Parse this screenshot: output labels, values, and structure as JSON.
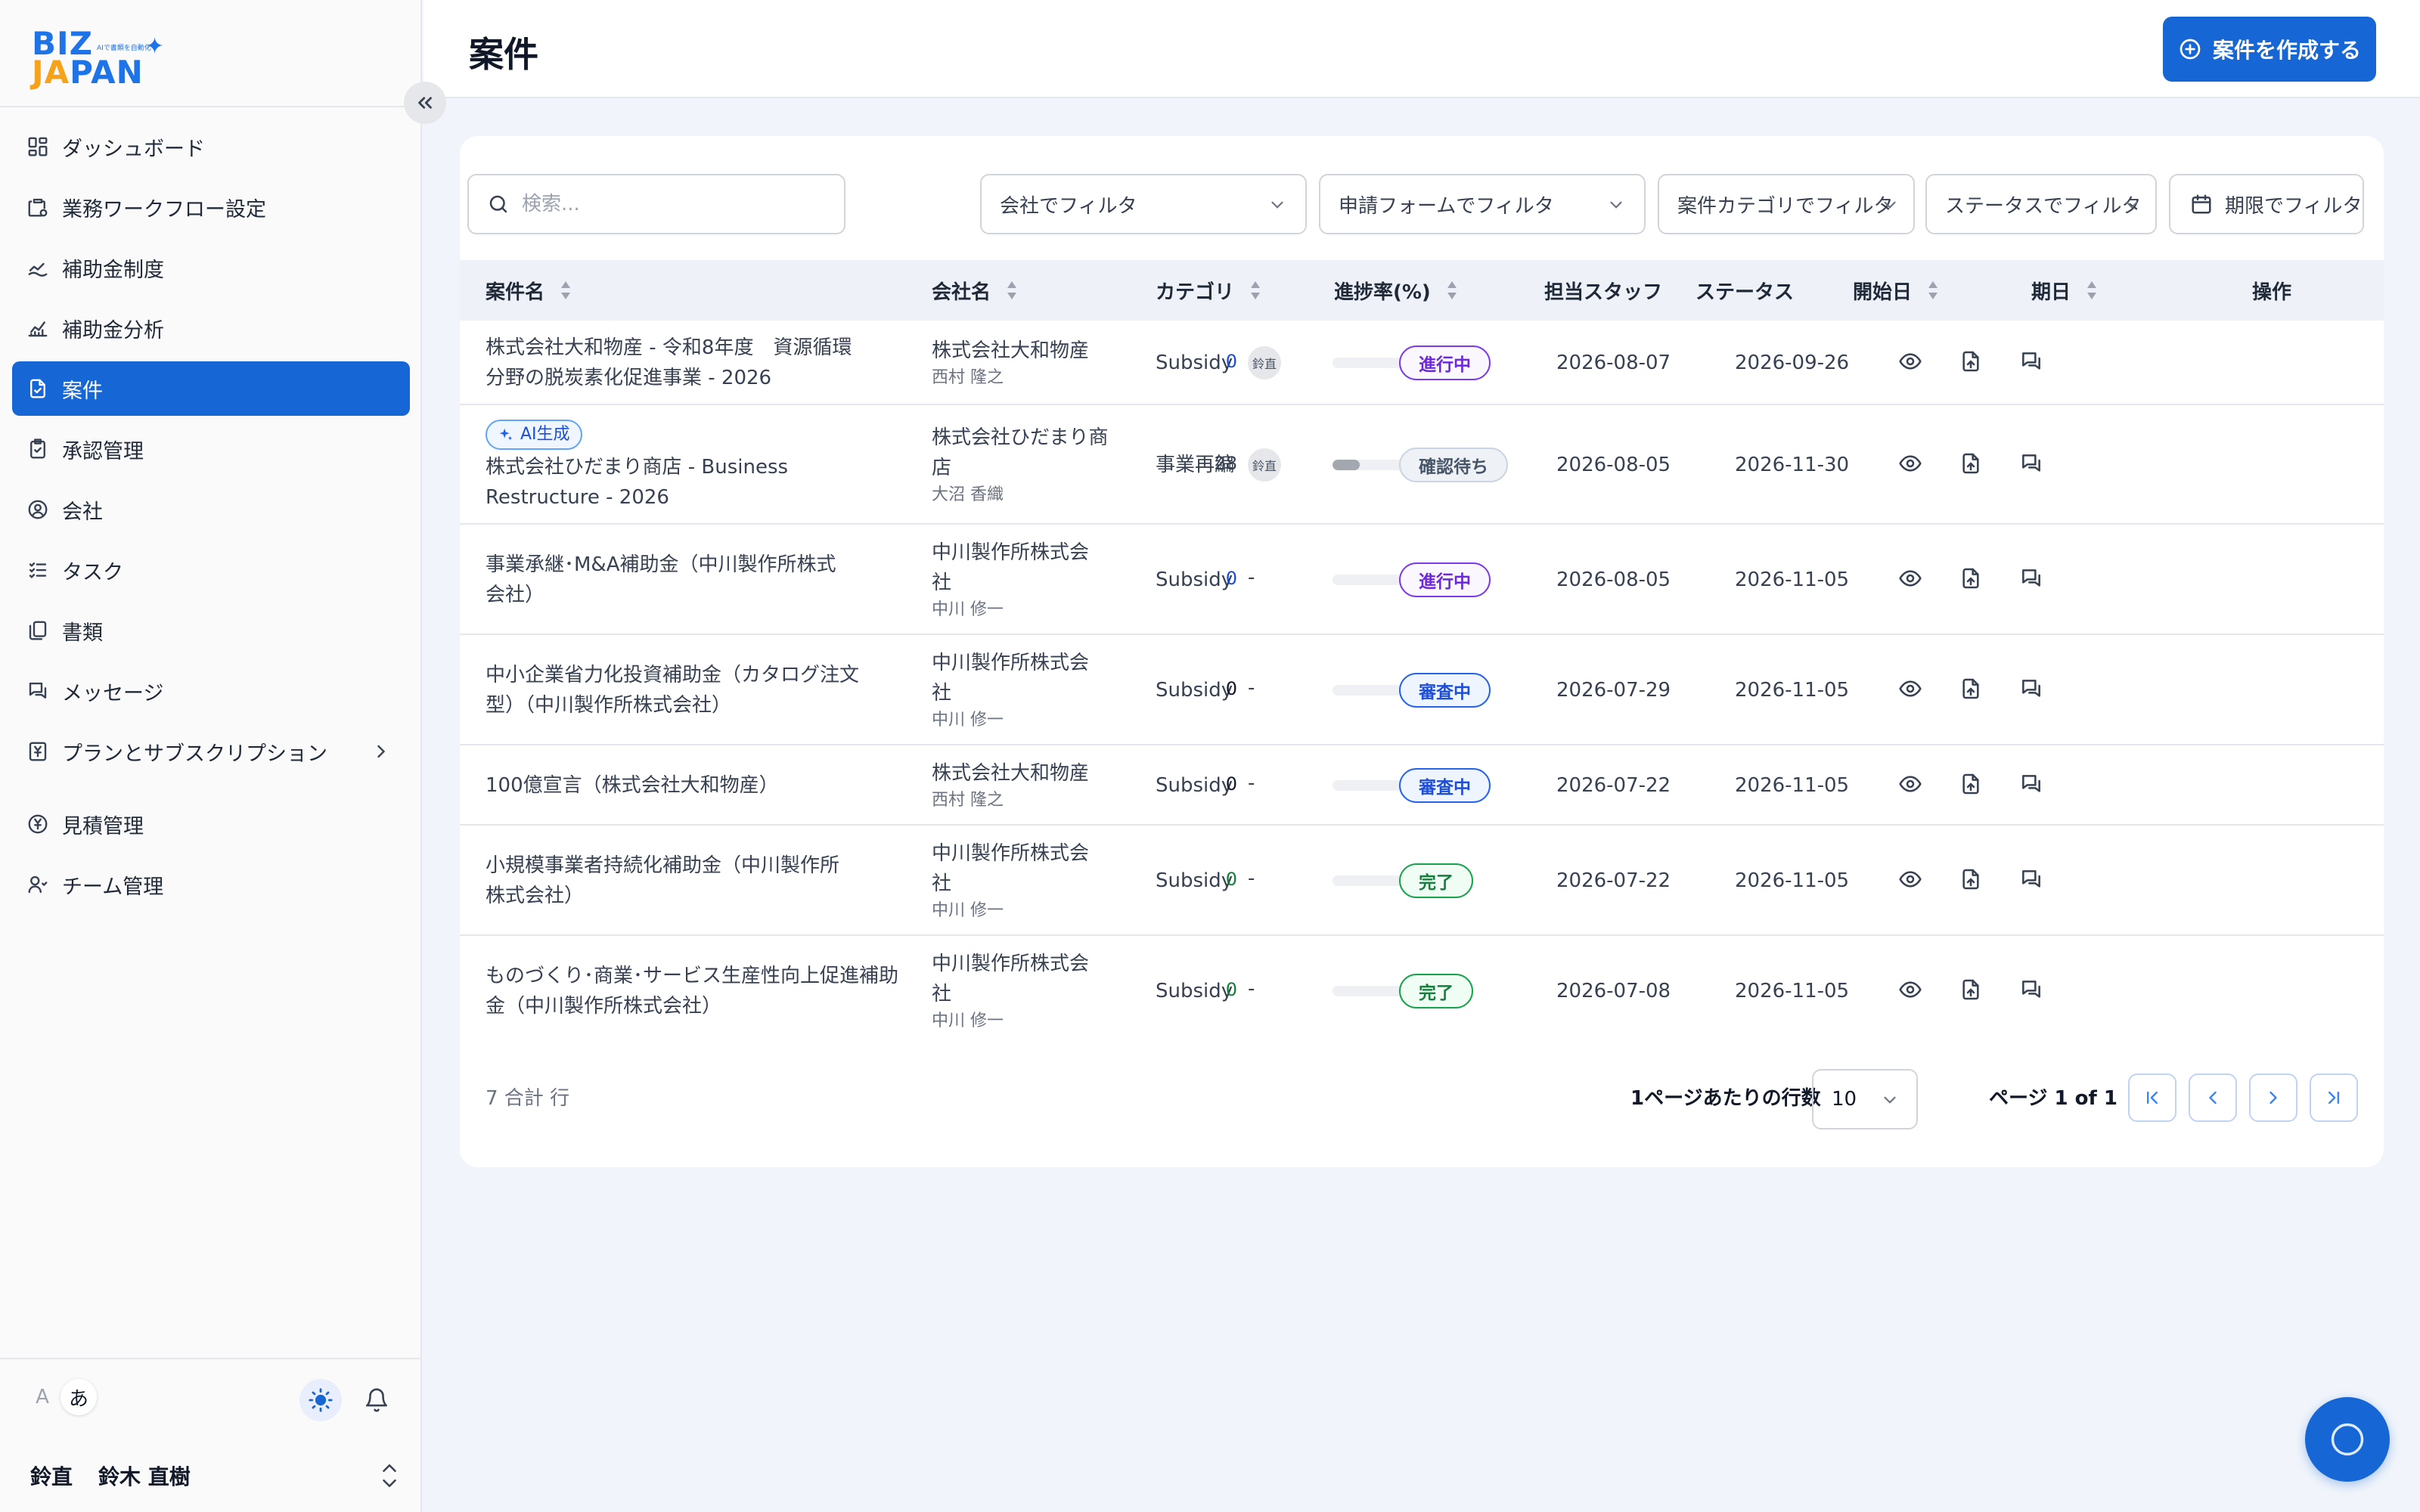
{
  "app": {
    "logo_top": "BIZ",
    "logo_bottom_a": "JA",
    "logo_bottom_b": "PAN",
    "logo_tagline": "AIで書類を自動化"
  },
  "sidebar": {
    "items": [
      {
        "label": "ダッシュボード",
        "icon": "dashboard-icon"
      },
      {
        "label": "業務ワークフロー設定",
        "icon": "workflow-icon"
      },
      {
        "label": "補助金制度",
        "icon": "subsidy-icon"
      },
      {
        "label": "補助金分析",
        "icon": "analytics-icon"
      },
      {
        "label": "案件",
        "icon": "case-icon",
        "active": true
      },
      {
        "label": "承認管理",
        "icon": "approval-icon"
      },
      {
        "label": "会社",
        "icon": "company-icon"
      },
      {
        "label": "タスク",
        "icon": "task-icon"
      },
      {
        "label": "書類",
        "icon": "document-icon"
      },
      {
        "label": "メッセージ",
        "icon": "message-icon"
      },
      {
        "label": "プランとサブスクリプション",
        "icon": "plan-icon"
      },
      {
        "label": "見積管理",
        "icon": "estimate-icon"
      },
      {
        "label": "チーム管理",
        "icon": "team-icon"
      }
    ],
    "lang_en": "A",
    "lang_ja": "あ",
    "user_badge": "鈴直",
    "user_name": "鈴木 直樹"
  },
  "header": {
    "title": "案件",
    "create_button": "案件を作成する"
  },
  "filters": {
    "search_placeholder": "検索...",
    "company": "会社でフィルタ",
    "form": "申請フォームでフィルタ",
    "category": "案件カテゴリでフィルタ",
    "status": "ステータスでフィルタ",
    "deadline": "期限でフィルタ"
  },
  "table": {
    "columns": [
      "案件名",
      "会社名",
      "カテゴリ",
      "進捗率(%)",
      "担当スタッフ",
      "ステータス",
      "開始日",
      "期日",
      "操作"
    ],
    "rows": [
      {
        "name_lines": [
          "株式会社大和物産 - 令和8年度　資源循環",
          "分野の脱炭素化促進事業 - 2026"
        ],
        "ai": "",
        "company_lines": [
          "株式会社大和物産"
        ],
        "contact": "西村 隆之",
        "category": "Subsidy",
        "progress": 0,
        "progress_label": "0",
        "progress_color": "#1d4ed8",
        "staff": "鈴直",
        "status": "進行中",
        "status_kind": "progress",
        "start": "2026-08-07",
        "due": "2026-09-26"
      },
      {
        "name_lines": [
          "株式会社ひだまり商店 - Business",
          "Restructure - 2026"
        ],
        "ai": "AI生成",
        "company_lines": [
          "株式会社ひだまり商",
          "店"
        ],
        "contact": "大沼 香織",
        "category": "事業再編",
        "progress": 28,
        "progress_label": "28",
        "progress_color": "#374151",
        "staff": "鈴直",
        "status": "確認待ち",
        "status_kind": "confirm",
        "start": "2026-08-05",
        "due": "2026-11-30"
      },
      {
        "name_lines": [
          "事業承継･M&A補助金（中川製作所株式",
          "会社）"
        ],
        "ai": "",
        "company_lines": [
          "中川製作所株式会",
          "社"
        ],
        "contact": "中川 修一",
        "category": "Subsidy",
        "progress": 0,
        "progress_label": "0",
        "progress_color": "#1d4ed8",
        "staff": "-",
        "status": "進行中",
        "status_kind": "progress",
        "start": "2026-08-05",
        "due": "2026-11-05"
      },
      {
        "name_lines": [
          "中小企業省力化投資補助金（カタログ注文",
          "型）（中川製作所株式会社）"
        ],
        "ai": "",
        "company_lines": [
          "中川製作所株式会",
          "社"
        ],
        "contact": "中川 修一",
        "category": "Subsidy",
        "progress": 0,
        "progress_label": "0",
        "progress_color": "#111827",
        "staff": "-",
        "status": "審査中",
        "status_kind": "review",
        "start": "2026-07-29",
        "due": "2026-11-05"
      },
      {
        "name_lines": [
          "100億宣言（株式会社大和物産）"
        ],
        "ai": "",
        "company_lines": [
          "株式会社大和物産"
        ],
        "contact": "西村 隆之",
        "category": "Subsidy",
        "progress": 0,
        "progress_label": "0",
        "progress_color": "#111827",
        "staff": "-",
        "status": "審査中",
        "status_kind": "review",
        "start": "2026-07-22",
        "due": "2026-11-05"
      },
      {
        "name_lines": [
          "小規模事業者持続化補助金（中川製作所",
          "株式会社）"
        ],
        "ai": "",
        "company_lines": [
          "中川製作所株式会",
          "社"
        ],
        "contact": "中川 修一",
        "category": "Subsidy",
        "progress": 0,
        "progress_label": "0",
        "progress_color": "#15803d",
        "staff": "-",
        "status": "完了",
        "status_kind": "done",
        "start": "2026-07-22",
        "due": "2026-11-05"
      },
      {
        "name_lines": [
          "ものづくり･商業･サービス生産性向上促進補助",
          "金（中川製作所株式会社）"
        ],
        "ai": "",
        "company_lines": [
          "中川製作所株式会",
          "社"
        ],
        "contact": "中川 修一",
        "category": "Subsidy",
        "progress": 0,
        "progress_label": "0",
        "progress_color": "#15803d",
        "staff": "-",
        "status": "完了",
        "status_kind": "done",
        "start": "2026-07-08",
        "due": "2026-11-05"
      }
    ]
  },
  "footer": {
    "total": "7 合計 行",
    "rows_per_page_label": "1ページあたりの行数",
    "rows_per_page": "10",
    "page_info": "ページ 1 of 1"
  }
}
